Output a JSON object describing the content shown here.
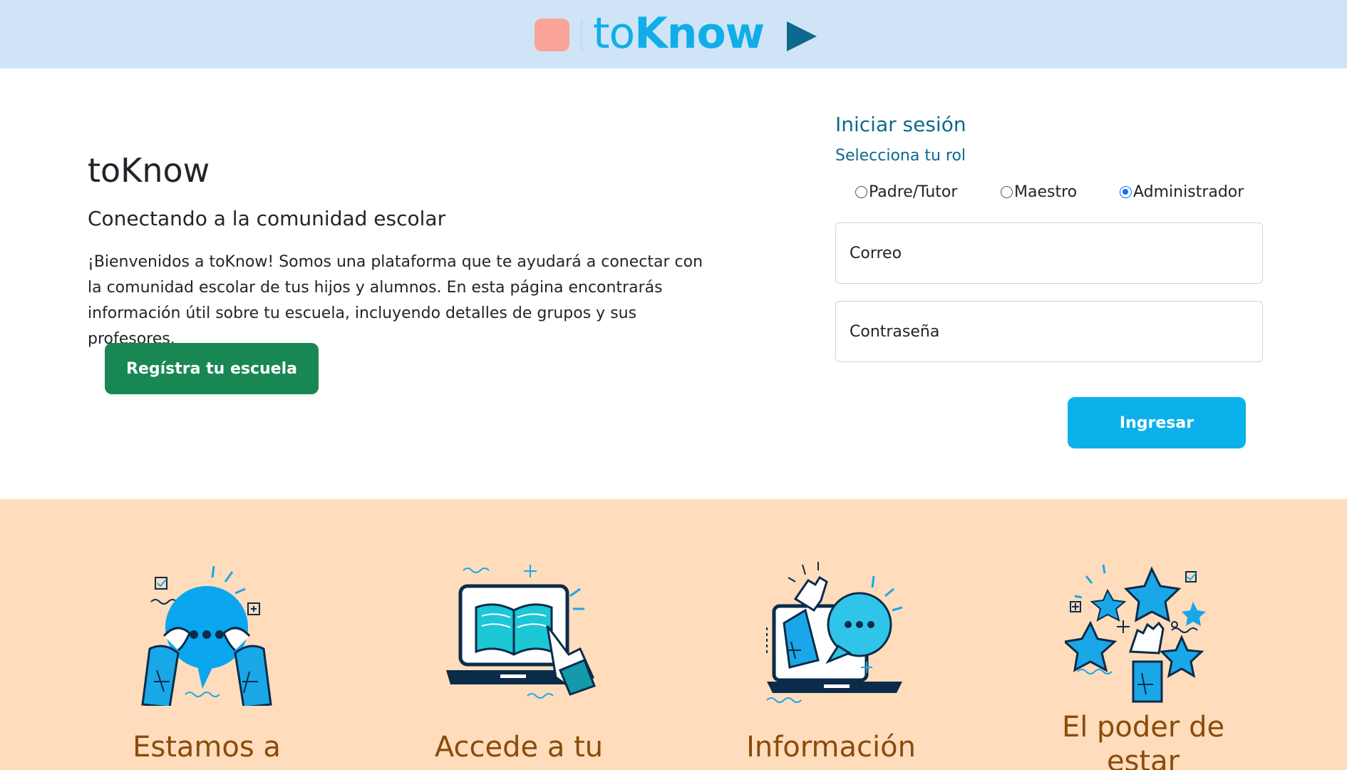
{
  "header": {
    "logo_text": "toKnow"
  },
  "hero": {
    "title": "toKnow",
    "subtitle": "Conectando a la comunidad escolar",
    "description": "¡Bienvenidos a toKnow! Somos una plataforma que te ayudará a conectar con la comunidad escolar de tus hijos y alumnos. En esta página encontrarás información útil sobre tu escuela, incluyendo detalles de grupos y sus profesores.",
    "register_label": "Regístra tu escuela"
  },
  "login": {
    "title": "Iniciar sesión",
    "role_label": "Selecciona tu rol",
    "roles": [
      {
        "label": "Padre/Tutor",
        "selected": false
      },
      {
        "label": "Maestro",
        "selected": false
      },
      {
        "label": "Administrador",
        "selected": true
      }
    ],
    "email_placeholder": "Correo",
    "password_placeholder": "Contraseña",
    "submit_label": "Ingresar"
  },
  "features": [
    {
      "title": "Estamos a",
      "icon": "chat-bubble-hands-icon"
    },
    {
      "title": "Accede a tu",
      "icon": "laptop-book-icon"
    },
    {
      "title": "Información",
      "icon": "laptop-chat-wave-icon"
    },
    {
      "title": "El poder de",
      "title2": "estar",
      "icon": "stars-hand-icon"
    }
  ],
  "colors": {
    "header_bg": "#cfe5f7",
    "brand": "#10aee9",
    "accent_dark": "#0d6a8e",
    "register_button": "#198754",
    "login_button": "#0bb1ea",
    "features_bg": "#fedcbc",
    "feature_title": "#8a4b0b"
  }
}
